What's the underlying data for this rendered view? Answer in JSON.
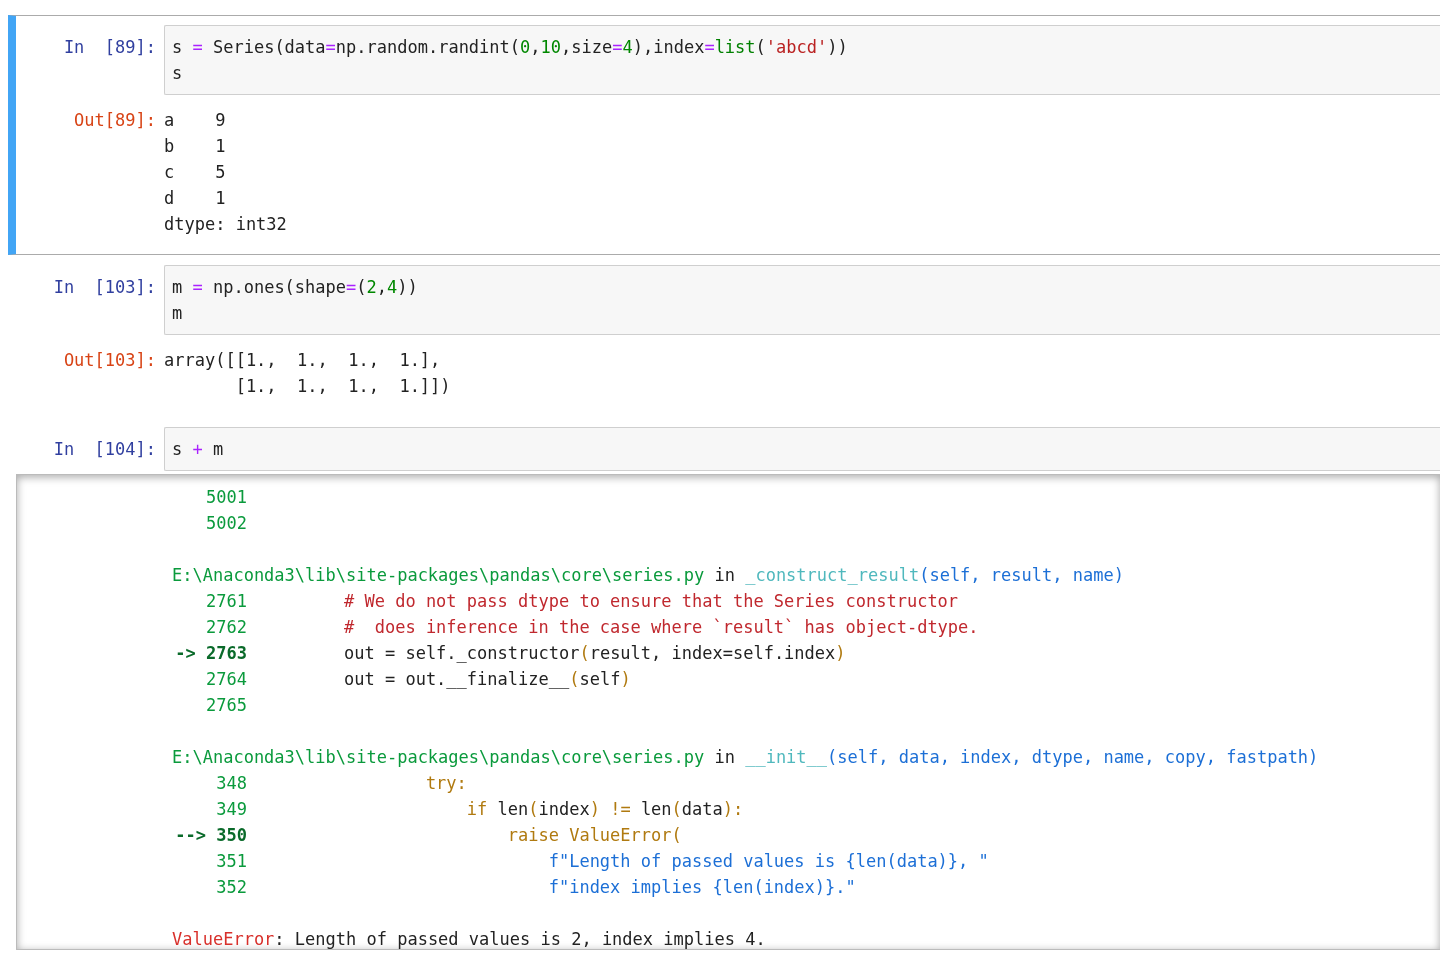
{
  "cells": [
    {
      "selected": true,
      "in_prompt": "In  [89]:",
      "input": [
        [
          {
            "kind": "name",
            "text": "s "
          },
          {
            "kind": "op",
            "text": "="
          },
          {
            "kind": "name",
            "text": " Series(data"
          },
          {
            "kind": "op",
            "text": "="
          },
          {
            "kind": "name",
            "text": "np.random.randint("
          },
          {
            "kind": "num",
            "text": "0"
          },
          {
            "kind": "name",
            "text": ","
          },
          {
            "kind": "num",
            "text": "10"
          },
          {
            "kind": "name",
            "text": ",size"
          },
          {
            "kind": "op",
            "text": "="
          },
          {
            "kind": "num",
            "text": "4"
          },
          {
            "kind": "name",
            "text": "),index"
          },
          {
            "kind": "op",
            "text": "="
          },
          {
            "kind": "builtin",
            "text": "list"
          },
          {
            "kind": "name",
            "text": "("
          },
          {
            "kind": "str",
            "text": "'abcd'"
          },
          {
            "kind": "name",
            "text": "))"
          }
        ],
        [
          {
            "kind": "name",
            "text": "s"
          }
        ]
      ],
      "out_prompt": "Out[89]:",
      "output": {
        "kind": "text",
        "lines": [
          "a    9",
          "b    1",
          "c    5",
          "d    1",
          "dtype: int32"
        ]
      }
    },
    {
      "selected": false,
      "in_prompt": "In  [103]:",
      "input": [
        [
          {
            "kind": "name",
            "text": "m "
          },
          {
            "kind": "op",
            "text": "="
          },
          {
            "kind": "name",
            "text": " np.ones(shape"
          },
          {
            "kind": "op",
            "text": "="
          },
          {
            "kind": "name",
            "text": "("
          },
          {
            "kind": "num",
            "text": "2"
          },
          {
            "kind": "name",
            "text": ","
          },
          {
            "kind": "num",
            "text": "4"
          },
          {
            "kind": "name",
            "text": "))"
          }
        ],
        [
          {
            "kind": "name",
            "text": "m"
          }
        ]
      ],
      "out_prompt": "Out[103]:",
      "output": {
        "kind": "text",
        "lines": [
          "array([[1.,  1.,  1.,  1.],",
          "       [1.,  1.,  1.,  1.]])"
        ]
      }
    },
    {
      "selected": false,
      "in_prompt": "In  [104]:",
      "input": [
        [
          {
            "kind": "name",
            "text": "s "
          },
          {
            "kind": "op",
            "text": "+"
          },
          {
            "kind": "name",
            "text": " m"
          }
        ]
      ],
      "output": {
        "kind": "traceback",
        "frames": [
          {
            "lines": [
              {
                "number": "5001",
                "current": false
              },
              {
                "number": "5002",
                "current": false
              }
            ]
          },
          {
            "header": [
              {
                "kind": "path",
                "text": "E:\\Anaconda3\\lib\\site-packages\\pandas\\core\\series.py"
              },
              {
                "kind": "plain",
                "text": " in "
              },
              {
                "kind": "func",
                "text": "_construct_result"
              },
              {
                "kind": "args",
                "text": "(self, result, name)"
              }
            ],
            "lines": [
              {
                "number": "2761",
                "current": false,
                "code": [
                  {
                    "kind": "comment",
                    "text": "# We do not pass dtype to ensure that the Series constructor"
                  }
                ]
              },
              {
                "number": "2762",
                "current": false,
                "code": [
                  {
                    "kind": "comment",
                    "text": "#  does inference in the case where `result` has object-dtype."
                  }
                ]
              },
              {
                "number": "-> 2763",
                "current": true,
                "code": [
                  {
                    "kind": "plain",
                    "text": "out = self._constructor"
                  },
                  {
                    "kind": "kw",
                    "text": "("
                  },
                  {
                    "kind": "plain",
                    "text": "result, index=self.index"
                  },
                  {
                    "kind": "kw",
                    "text": ")"
                  }
                ]
              },
              {
                "number": "2764",
                "current": false,
                "code": [
                  {
                    "kind": "plain",
                    "text": "out = out.__finalize__"
                  },
                  {
                    "kind": "kw",
                    "text": "("
                  },
                  {
                    "kind": "plain",
                    "text": "self"
                  },
                  {
                    "kind": "kw",
                    "text": ")"
                  }
                ]
              },
              {
                "number": "2765",
                "current": false
              }
            ]
          },
          {
            "header": [
              {
                "kind": "path",
                "text": "E:\\Anaconda3\\lib\\site-packages\\pandas\\core\\series.py"
              },
              {
                "kind": "plain",
                "text": " in "
              },
              {
                "kind": "func",
                "text": "__init__"
              },
              {
                "kind": "args",
                "text": "(self, data, index, dtype, name, copy, fastpath)"
              }
            ],
            "lines": [
              {
                "number": "348",
                "current": false,
                "code": [
                  {
                    "kind": "kw",
                    "text": "        try:"
                  }
                ]
              },
              {
                "number": "349",
                "current": false,
                "code": [
                  {
                    "kind": "kw",
                    "text": "            if"
                  },
                  {
                    "kind": "plain",
                    "text": " len"
                  },
                  {
                    "kind": "kw",
                    "text": "("
                  },
                  {
                    "kind": "plain",
                    "text": "index"
                  },
                  {
                    "kind": "kw",
                    "text": ") !="
                  },
                  {
                    "kind": "plain",
                    "text": " len"
                  },
                  {
                    "kind": "kw",
                    "text": "("
                  },
                  {
                    "kind": "plain",
                    "text": "data"
                  },
                  {
                    "kind": "kw",
                    "text": "):"
                  }
                ]
              },
              {
                "number": "--> 350",
                "current": true,
                "code": [
                  {
                    "kind": "kw",
                    "text": "                raise ValueError("
                  }
                ]
              },
              {
                "number": "351",
                "current": false,
                "code": [
                  {
                    "kind": "string",
                    "text": "                    f\"Length of passed values is {len(data)}, \""
                  }
                ]
              },
              {
                "number": "352",
                "current": false,
                "code": [
                  {
                    "kind": "string",
                    "text": "                    f\"index implies {len(index)}.\""
                  }
                ]
              }
            ]
          }
        ],
        "error": [
          {
            "kind": "error",
            "text": "ValueError"
          },
          {
            "kind": "plain",
            "text": ": Length of passed values is 2, index implies 4."
          }
        ]
      }
    }
  ]
}
